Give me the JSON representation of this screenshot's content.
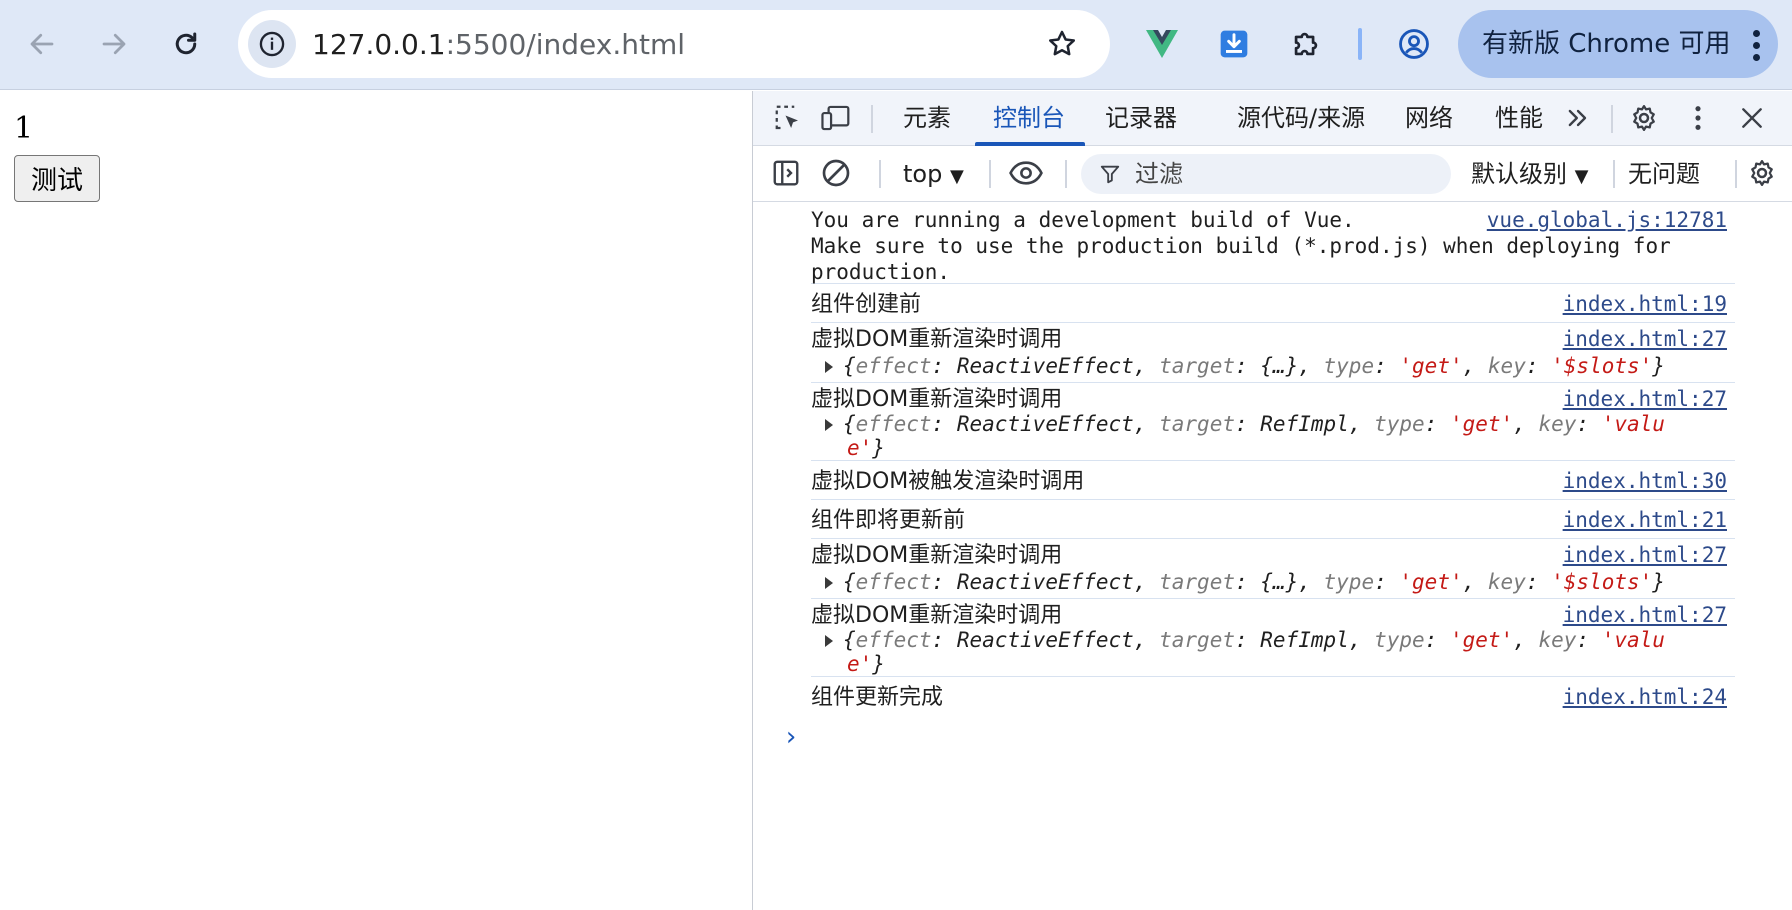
{
  "browser": {
    "url_host": "127.0.0.1",
    "url_path": ":5500/index.html",
    "update_label": "有新版 Chrome 可用",
    "icons": [
      "back-icon",
      "forward-icon",
      "reload-icon",
      "site-info-icon",
      "bookmark-star-icon",
      "vue-devtools-icon",
      "download-extension-icon",
      "extensions-puzzle-icon",
      "profile-icon",
      "more-menu-icon"
    ]
  },
  "page": {
    "counter": "1",
    "test_button": "测试"
  },
  "devtools": {
    "tabs": [
      "元素",
      "控制台",
      "记录器",
      "源代码/来源",
      "网络",
      "性能"
    ],
    "active_tab": "控制台",
    "context": "top",
    "filter_placeholder": "过滤",
    "levels": "默认级别",
    "issues": "无问题",
    "messages": [
      {
        "lines": [
          "You are running a development build of Vue.",
          "Make sure to use the production build (*.prod.js) when deploying for",
          "production."
        ],
        "source": "vue.global.js:12781"
      },
      {
        "text": "组件创建前",
        "source": "index.html:19"
      },
      {
        "text": "虚拟DOM重新渲染时调用",
        "source": "index.html:27",
        "object": {
          "effect": "ReactiveEffect",
          "target": "{…}",
          "type": "'get'",
          "key": "'$slots'"
        }
      },
      {
        "text": "虚拟DOM重新渲染时调用",
        "source": "index.html:27",
        "object": {
          "effect": "ReactiveEffect",
          "target": "RefImpl",
          "type": "'get'",
          "key_a": "'valu",
          "key_b": "e'"
        }
      },
      {
        "text": "虚拟DOM被触发渲染时调用",
        "source": "index.html:30"
      },
      {
        "text": "组件即将更新前",
        "source": "index.html:21"
      },
      {
        "text": "虚拟DOM重新渲染时调用",
        "source": "index.html:27",
        "object": {
          "effect": "ReactiveEffect",
          "target": "{…}",
          "type": "'get'",
          "key": "'$slots'"
        }
      },
      {
        "text": "虚拟DOM重新渲染时调用",
        "source": "index.html:27",
        "object": {
          "effect": "ReactiveEffect",
          "target": "RefImpl",
          "type": "'get'",
          "key_a": "'valu",
          "key_b": "e'"
        }
      },
      {
        "text": "组件更新完成",
        "source": "index.html:24"
      }
    ],
    "prompt": "›"
  },
  "colors": {
    "toolbar_bg": "#dfe8f7",
    "accent_blue": "#1a56b8",
    "update_pill": "#a8c2ee",
    "string_red": "#c41a16",
    "link": "#2d4a8a"
  }
}
